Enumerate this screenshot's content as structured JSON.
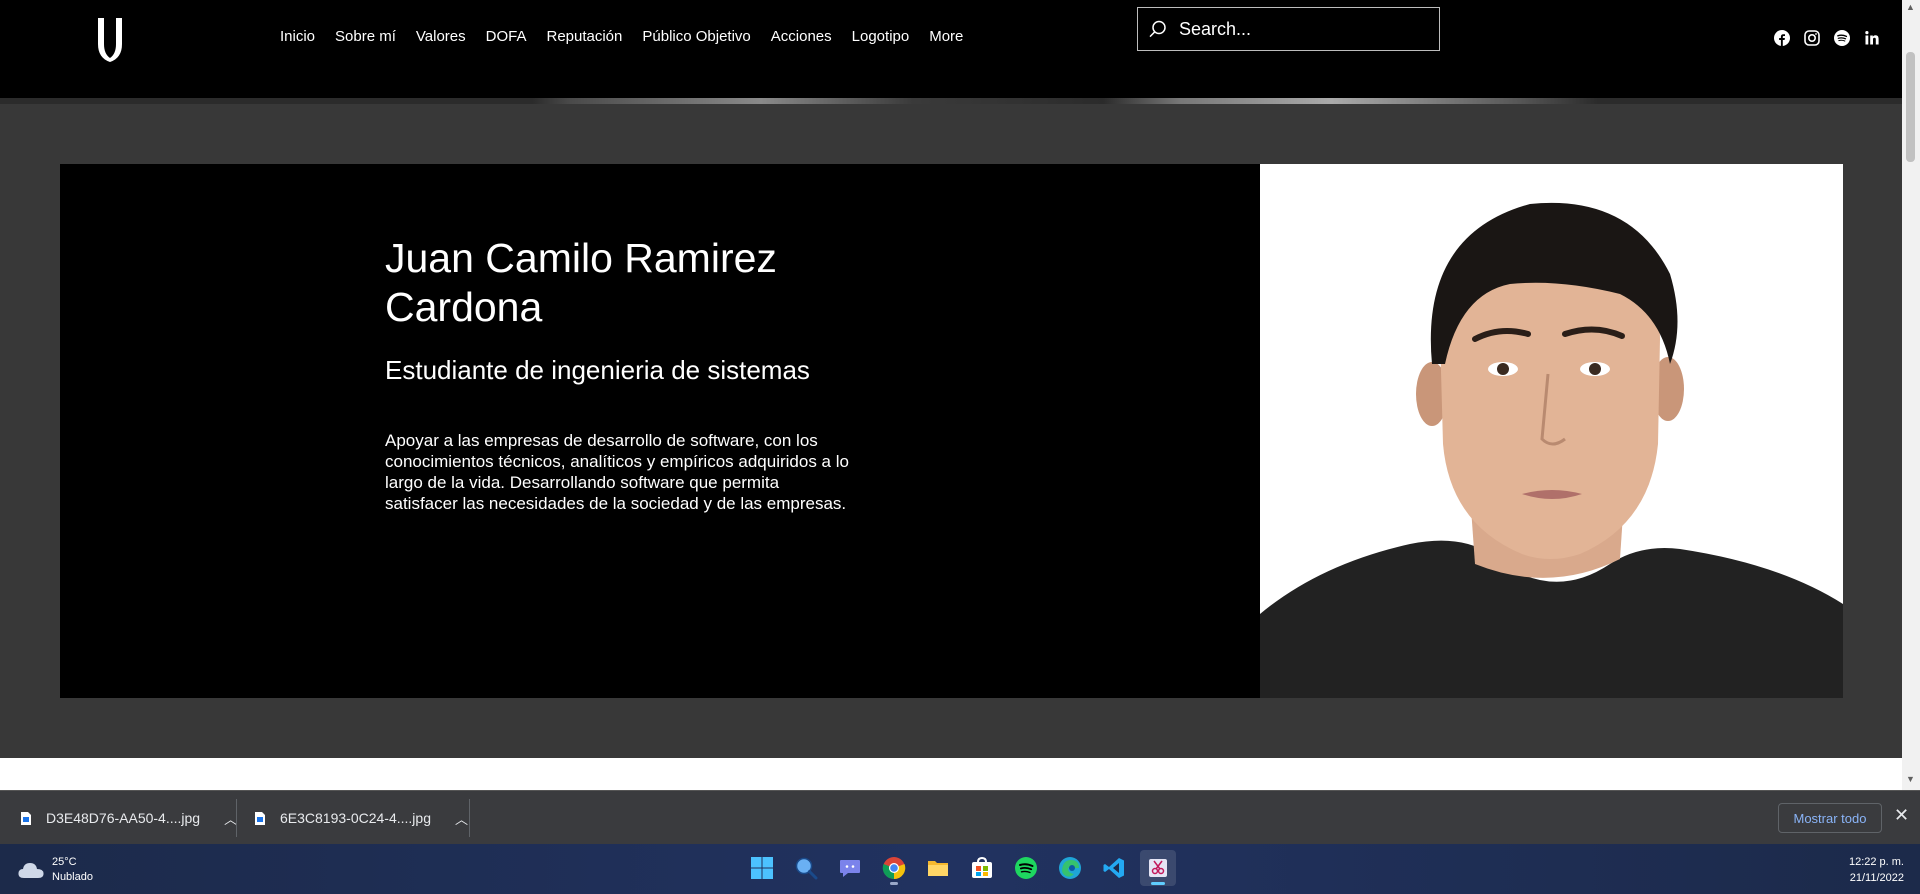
{
  "nav": {
    "menu": [
      "Inicio",
      "Sobre mí",
      "Valores",
      "DOFA",
      "Reputación",
      "Público Objetivo",
      "Acciones",
      "Logotipo",
      "More"
    ],
    "search_placeholder": "Search...",
    "socials": [
      "facebook-icon",
      "instagram-icon",
      "spotify-icon",
      "linkedin-icon"
    ]
  },
  "hero": {
    "name": "Juan Camilo Ramirez Cardona",
    "role": "Estudiante de ingenieria de sistemas",
    "description": "Apoyar a las empresas de desarrollo de software, con los conocimientos técnicos, analíticos y empíricos adquiridos a lo largo de la vida. Desarrollando software que permita satisfacer las necesidades de la sociedad y de las empresas."
  },
  "downloads": {
    "items": [
      {
        "name": "D3E48D76-AA50-4....jpg"
      },
      {
        "name": "6E3C8193-0C24-4....jpg"
      }
    ],
    "show_all": "Mostrar todo"
  },
  "taskbar": {
    "weather_temp": "25°C",
    "weather_desc": "Nublado",
    "time": "12:22 p. m.",
    "date": "21/11/2022",
    "apps": [
      "windows-start-icon",
      "search-icon",
      "teams-chat-icon",
      "chrome-icon",
      "file-explorer-icon",
      "microsoft-store-icon",
      "spotify-icon",
      "edge-icon",
      "vscode-icon",
      "snipping-tool-icon"
    ]
  }
}
